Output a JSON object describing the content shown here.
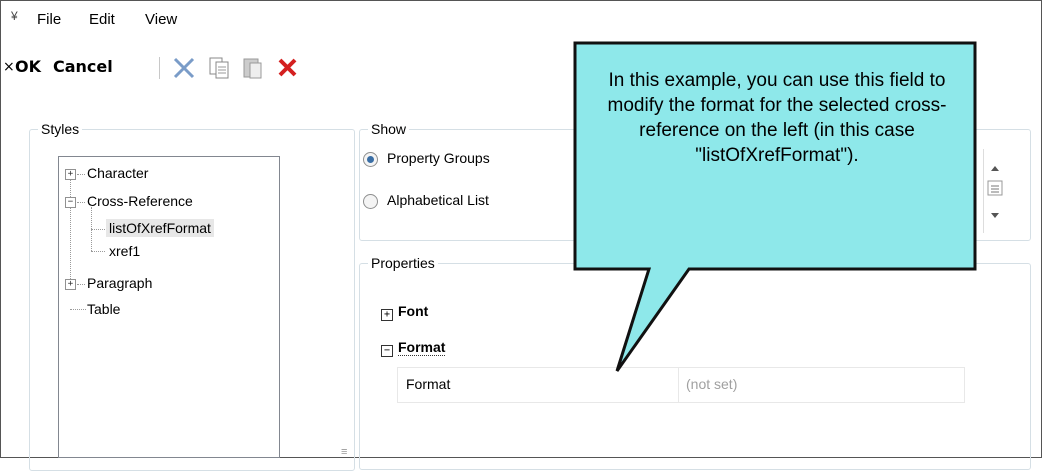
{
  "menubar": {
    "grip": "¥",
    "items": [
      "File",
      "Edit",
      "View"
    ]
  },
  "toolbar": {
    "close": "×",
    "ok": "OK",
    "cancel": "Cancel",
    "icons": [
      "cut-icon",
      "copy-icon",
      "paste-icon",
      "delete-icon"
    ]
  },
  "styles": {
    "title": "Styles",
    "tree": [
      {
        "label": "Character",
        "expander": "+"
      },
      {
        "label": "Cross-Reference",
        "expander": "−"
      },
      {
        "label": "listOfXrefFormat",
        "selected": true
      },
      {
        "label": "xref1"
      },
      {
        "label": "Paragraph",
        "expander": "+"
      },
      {
        "label": "Table"
      }
    ]
  },
  "show": {
    "title": "Show",
    "options": [
      "Property Groups",
      "Alphabetical List"
    ],
    "selected": 0
  },
  "properties": {
    "title": "Properties",
    "groups": [
      {
        "label": "Font",
        "expander": "+"
      },
      {
        "label": "Format",
        "expander": "−"
      }
    ],
    "rows": [
      {
        "name": "Format",
        "value": "(not set)"
      }
    ]
  },
  "callout": {
    "text": "In this example, you can use this field to modify the format for the selected cross-reference on the left (in this case \"listOfXrefFormat\")."
  },
  "colors": {
    "callout_fill": "#8ee8ea",
    "callout_border": "#111111",
    "accent": "#3a6ea5"
  }
}
